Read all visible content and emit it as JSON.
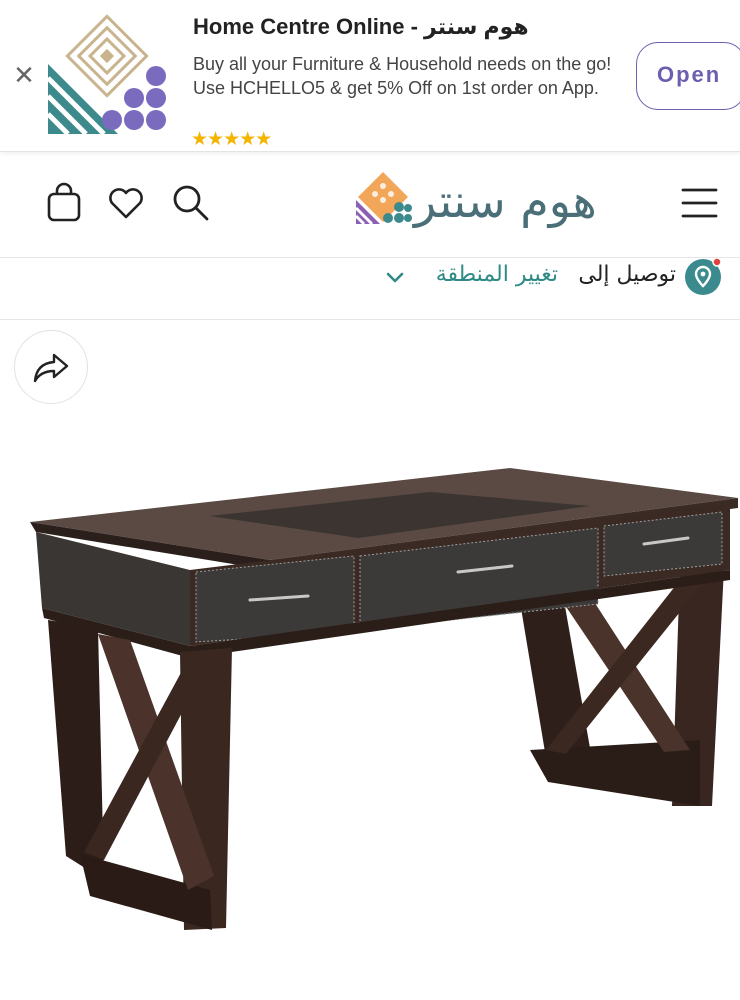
{
  "banner": {
    "title": "Home Centre Online - هوم سنتر",
    "description": "Buy all your Furniture & Household needs on the go! Use HCHELLO5 & get 5% Off on 1st order on App.",
    "rating_stars": "★★★★★",
    "open_label": "Open",
    "close_label": "✕"
  },
  "header": {
    "logo_text": "هوم سنتر",
    "icons": [
      "bag-icon",
      "heart-icon",
      "search-icon",
      "menu-icon"
    ]
  },
  "delivery": {
    "label": "توصيل إلى",
    "change_region": "تغيير المنطقة"
  },
  "product": {
    "image_alt": "desk"
  },
  "colors": {
    "brand_teal": "#4a6f78",
    "accent_purple": "#6b5fb0",
    "link_teal": "#2f8a86",
    "star": "#f4b400"
  }
}
